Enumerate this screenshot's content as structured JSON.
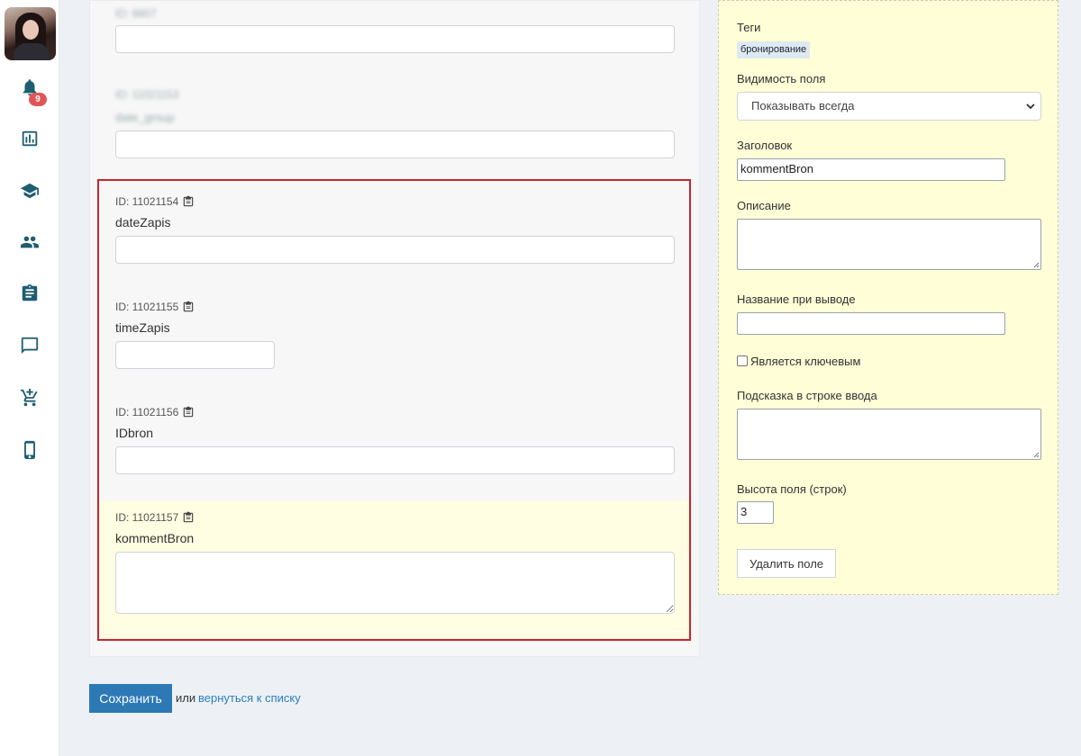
{
  "sidebar": {
    "notifications_count": "9",
    "items": [
      {
        "icon": "bell-icon"
      },
      {
        "icon": "chart-icon"
      },
      {
        "icon": "graduation-cap-icon"
      },
      {
        "icon": "people-icon"
      },
      {
        "icon": "clipboard-icon"
      },
      {
        "icon": "chat-icon"
      },
      {
        "icon": "cart-add-icon"
      },
      {
        "icon": "phone-icon"
      }
    ]
  },
  "form": {
    "blurred_fields": [
      {
        "id_text": "ID: 8807",
        "name": ""
      },
      {
        "id_text": "ID: 11021153",
        "name": "date_group"
      }
    ],
    "fields": [
      {
        "id_text": "ID: 11021154",
        "name": "dateZapis"
      },
      {
        "id_text": "ID: 11021155",
        "name": "timeZapis"
      },
      {
        "id_text": "ID: 11021156",
        "name": "IDbron"
      },
      {
        "id_text": "ID: 11021157",
        "name": "kommentBron"
      }
    ],
    "save_label": "Сохранить",
    "or_text": "или",
    "back_link": "вернуться к списку"
  },
  "props": {
    "tags_label": "Теги",
    "tag": "бронирование",
    "visibility_label": "Видимость поля",
    "visibility_value": "Показывать всегда",
    "title_label": "Заголовок",
    "title_value": "kommentBron",
    "description_label": "Описание",
    "output_name_label": "Название при выводе",
    "key_label": "Является ключевым",
    "hint_label": "Подсказка в строке ввода",
    "height_label": "Высота поля (строк)",
    "height_value": "3",
    "delete_label": "Удалить поле"
  }
}
